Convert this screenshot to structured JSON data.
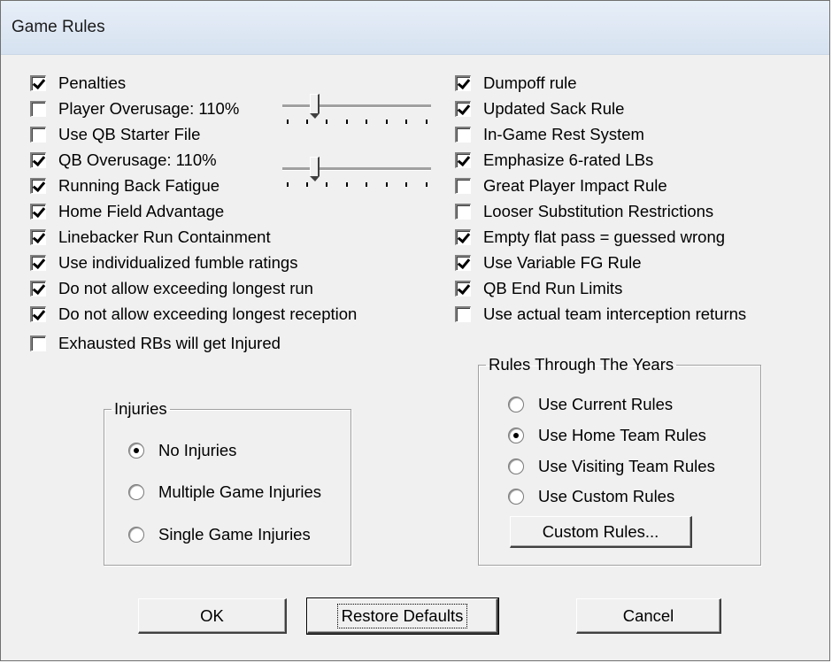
{
  "window": {
    "title": "Game Rules"
  },
  "left_options": [
    {
      "label": "Penalties",
      "checked": true
    },
    {
      "label": "Player Overusage: 110%",
      "checked": false
    },
    {
      "label": "Use QB Starter File",
      "checked": false
    },
    {
      "label": "QB Overusage: 110%",
      "checked": true
    },
    {
      "label": "Running Back Fatigue",
      "checked": true
    },
    {
      "label": "Home Field Advantage",
      "checked": true
    },
    {
      "label": "Linebacker Run Containment",
      "checked": true
    },
    {
      "label": "Use individualized fumble ratings",
      "checked": true
    },
    {
      "label": "Do not allow exceeding longest run",
      "checked": true
    },
    {
      "label": "Do not allow exceeding longest reception",
      "checked": true
    },
    {
      "label": "Exhausted RBs will get Injured",
      "checked": false
    }
  ],
  "right_options": [
    {
      "label": "Dumpoff rule",
      "checked": true
    },
    {
      "label": "Updated Sack Rule",
      "checked": true
    },
    {
      "label": "In-Game Rest System",
      "checked": false
    },
    {
      "label": "Emphasize 6-rated LBs",
      "checked": true
    },
    {
      "label": "Great Player Impact Rule",
      "checked": false
    },
    {
      "label": "Looser Substitution Restrictions",
      "checked": false
    },
    {
      "label": "Empty flat pass = guessed wrong",
      "checked": true
    },
    {
      "label": "Use Variable FG Rule",
      "checked": true
    },
    {
      "label": "QB End Run Limits",
      "checked": true
    },
    {
      "label": "Use actual team interception returns",
      "checked": false
    }
  ],
  "sliders": {
    "player_overusage": {
      "value_fraction": 0.2,
      "tick_count": 8
    },
    "qb_overusage": {
      "value_fraction": 0.2,
      "tick_count": 8
    }
  },
  "injuries": {
    "legend": "Injuries",
    "options": [
      {
        "label": "No Injuries",
        "selected": true
      },
      {
        "label": "Multiple Game Injuries",
        "selected": false
      },
      {
        "label": "Single Game Injuries",
        "selected": false
      }
    ]
  },
  "rules_years": {
    "legend": "Rules Through The Years",
    "options": [
      {
        "label": "Use Current Rules",
        "selected": false
      },
      {
        "label": "Use Home Team Rules",
        "selected": true
      },
      {
        "label": "Use Visiting Team Rules",
        "selected": false
      },
      {
        "label": "Use Custom Rules",
        "selected": false
      }
    ],
    "custom_button": "Custom Rules..."
  },
  "buttons": {
    "ok": "OK",
    "restore": "Restore Defaults",
    "cancel": "Cancel"
  }
}
